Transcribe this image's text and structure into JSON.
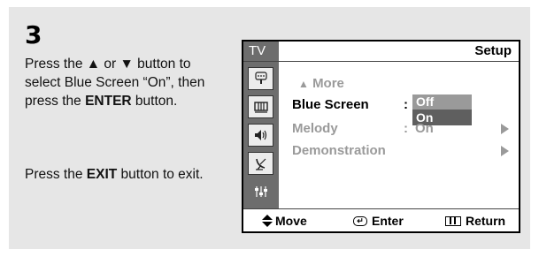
{
  "step": {
    "number": "3"
  },
  "instructions": {
    "line1_pre": "Press the ",
    "up_symbol": "▲",
    "line1_mid": " or ",
    "down_symbol": "▼",
    "line1_post": " button to select Blue Screen “On”, then press the ",
    "enter_word": "ENTER",
    "line1_end": " button.",
    "line2_pre": "Press the ",
    "exit_word": "EXIT",
    "line2_post": " button to exit."
  },
  "osd": {
    "tab_label": "TV",
    "title": "Setup",
    "sidebar_icons": [
      "input-icon",
      "picture-icon",
      "sound-icon",
      "channel-icon",
      "setup-icon"
    ],
    "menu": {
      "more_arrow": "▲",
      "more_label": "More",
      "items": [
        {
          "label": "Blue Screen",
          "colon": ":",
          "value": "",
          "selected": true
        },
        {
          "label": "Melody",
          "colon": ":",
          "value": "On",
          "selected": false
        },
        {
          "label": "Demonstration",
          "colon": "",
          "value": "",
          "selected": false
        }
      ]
    },
    "dropdown": {
      "options": [
        "Off",
        "On"
      ],
      "highlighted": "On"
    },
    "footer": {
      "move_label": "Move",
      "enter_label": "Enter",
      "return_label": "Return"
    }
  },
  "colors": {
    "panel_bg": "#e6e6e6",
    "sidebar_bg": "#6d6d6d",
    "dim_text": "#9a9a9a",
    "highlight_bg": "#5f5f5f"
  }
}
